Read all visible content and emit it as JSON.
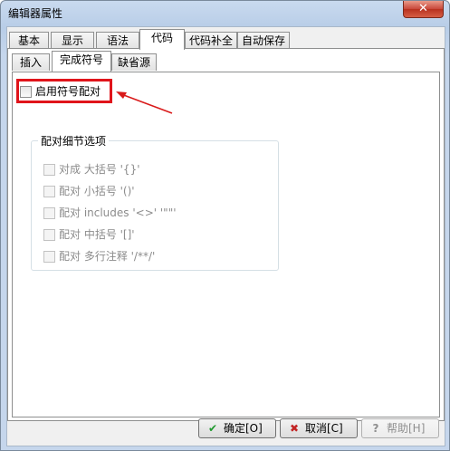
{
  "window": {
    "title": "编辑器属性",
    "close_label": "✕"
  },
  "tabs": [
    {
      "label": "基本"
    },
    {
      "label": "显示"
    },
    {
      "label": "语法"
    },
    {
      "label": "代码"
    },
    {
      "label": "代码补全"
    },
    {
      "label": "自动保存"
    }
  ],
  "subtabs": [
    {
      "label": "插入"
    },
    {
      "label": "完成符号"
    },
    {
      "label": "缺省源"
    }
  ],
  "enable_pairing": {
    "label": "启用符号配对",
    "checked": false
  },
  "group": {
    "title": "配对细节选项",
    "options": [
      {
        "label": "对成 大括号 '{}'"
      },
      {
        "label": "配对 小括号 '()'"
      },
      {
        "label": "配对 includes '<>' '\"\"'"
      },
      {
        "label": "配对 中括号 '[]'"
      },
      {
        "label": "配对 多行注释 '/**/'"
      }
    ]
  },
  "buttons": {
    "ok": "确定[O]",
    "cancel": "取消[C]",
    "help": "帮助[H]"
  },
  "colors": {
    "highlight": "#e0141b",
    "arrow": "#d91a1a",
    "ok_icon": "#1f9a2e",
    "cancel_icon": "#c22323"
  }
}
